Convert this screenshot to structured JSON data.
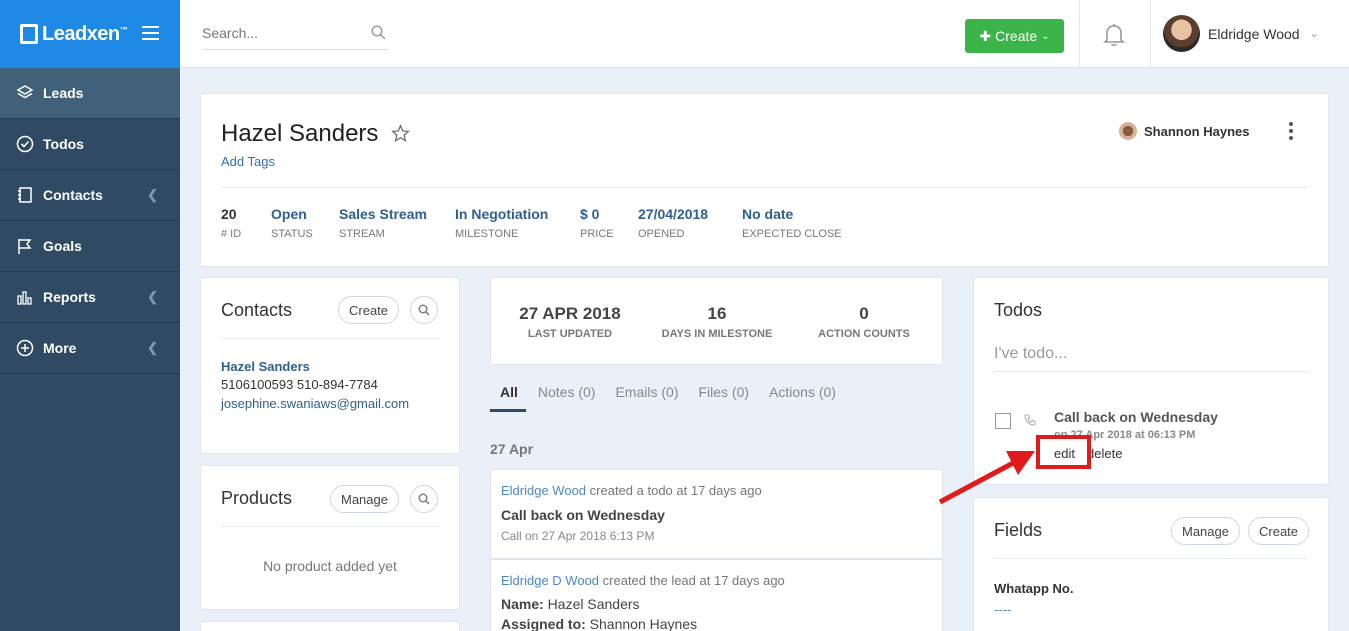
{
  "brand": {
    "name": "Leadxen",
    "tm": "™"
  },
  "sidebar": {
    "items": [
      {
        "label": "Leads",
        "icon": "layers-icon"
      },
      {
        "label": "Todos",
        "icon": "check-circle-icon"
      },
      {
        "label": "Contacts",
        "icon": "address-book-icon"
      },
      {
        "label": "Goals",
        "icon": "flag-icon"
      },
      {
        "label": "Reports",
        "icon": "bar-chart-icon"
      },
      {
        "label": "More",
        "icon": "plus-circle-icon"
      }
    ]
  },
  "topbar": {
    "search_placeholder": "Search...",
    "create_label": "Create",
    "user_name": "Eldridge Wood"
  },
  "lead": {
    "name": "Hazel Sanders",
    "add_tags": "Add Tags",
    "owner": "Shannon Haynes",
    "stats": [
      {
        "value": "20",
        "label": "# ID"
      },
      {
        "value": "Open",
        "label": "STATUS"
      },
      {
        "value": "Sales Stream",
        "label": "STREAM"
      },
      {
        "value": "In Negotiation",
        "label": "MILESTONE"
      },
      {
        "value": "$ 0",
        "label": "PRICE"
      },
      {
        "value": "27/04/2018",
        "label": "OPENED"
      },
      {
        "value": "No date",
        "label": "EXPECTED CLOSE"
      }
    ]
  },
  "contacts": {
    "title": "Contacts",
    "create_label": "Create",
    "name": "Hazel Sanders",
    "phones": "5106100593 510-894-7784",
    "email": "josephine.swaniaws@gmail.com"
  },
  "products": {
    "title": "Products",
    "manage_label": "Manage",
    "empty_text": "No product added yet"
  },
  "summary": [
    {
      "value": "27 APR 2018",
      "label": "LAST UPDATED"
    },
    {
      "value": "16",
      "label": "DAYS IN MILESTONE"
    },
    {
      "value": "0",
      "label": "ACTION COUNTS"
    }
  ],
  "tabs": [
    "All",
    "Notes (0)",
    "Emails (0)",
    "Files (0)",
    "Actions (0)"
  ],
  "activity_date": "27 Apr",
  "activities": [
    {
      "actor": "Eldridge Wood",
      "action": " created a todo at 17 days ago",
      "title": "Call back on Wednesday",
      "sub": "Call on 27 Apr 2018 6:13 PM"
    },
    {
      "actor": "Eldridge D Wood",
      "action": " created the lead at 17 days ago",
      "name_label": "Name:",
      "name_value": " Hazel Sanders",
      "assigned_label": "Assigned to:",
      "assigned_value": " Shannon Haynes"
    }
  ],
  "todos": {
    "title": "Todos",
    "input_placeholder": "I've todo...",
    "item_title": "Call back on Wednesday",
    "item_date": "on 27 Apr 2018 at 06:13 PM",
    "edit_label": "edit",
    "delete_label": "delete"
  },
  "fields": {
    "title": "Fields",
    "manage_label": "Manage",
    "create_label": "Create",
    "field_label": "Whatapp No.",
    "field_value": "----"
  },
  "colors": {
    "brand_blue": "#1e88e5",
    "sidebar": "#2f4a62",
    "create_green": "#3bb54a",
    "highlight_red": "#e01b1b"
  }
}
